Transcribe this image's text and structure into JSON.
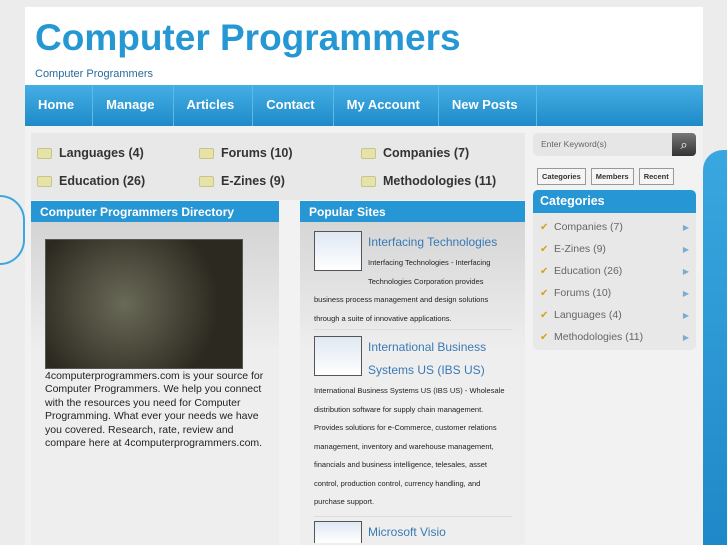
{
  "header": {
    "title": "Computer Programmers",
    "tagline": "Computer Programmers"
  },
  "nav": [
    "Home",
    "Manage",
    "Articles",
    "Contact",
    "My Account",
    "New Posts"
  ],
  "categories_grid": [
    "Languages (4)",
    "Forums (10)",
    "Companies (7)",
    "Education (26)",
    "E-Zines (9)",
    "Methodologies (11)"
  ],
  "directory": {
    "heading": "Computer Programmers Directory",
    "text": "4computerprogrammers.com is your source for Computer Programmers. We help you connect with the resources you need for Computer Programming. What ever your needs we have you covered. Research, rate, review and compare here at 4computerprogrammers.com."
  },
  "popular": {
    "heading": "Popular Sites",
    "sites": [
      {
        "title": "Interfacing Technologies",
        "desc": "Interfacing Technologies - Interfacing Technologies Corporation provides business process management and design solutions through a suite of innovative applications."
      },
      {
        "title": "International Business Systems US (IBS US)",
        "desc": "International Business Systems US (IBS US) - Wholesale distribution software for supply chain management. Provides solutions for e-Commerce, customer relations management, inventory and warehouse management, financials and business intelligence, telesales, asset control, production control, currency handling, and purchase support."
      },
      {
        "title": "Microsoft Visio",
        "desc": ""
      }
    ]
  },
  "search": {
    "placeholder": "Enter Keyword(s)"
  },
  "tabs": [
    "Categories",
    "Members",
    "Recent"
  ],
  "sidebar": {
    "heading": "Categories",
    "items": [
      "Companies (7)",
      "E-Zines (9)",
      "Education (26)",
      "Forums (10)",
      "Languages (4)",
      "Methodologies (11)"
    ]
  }
}
